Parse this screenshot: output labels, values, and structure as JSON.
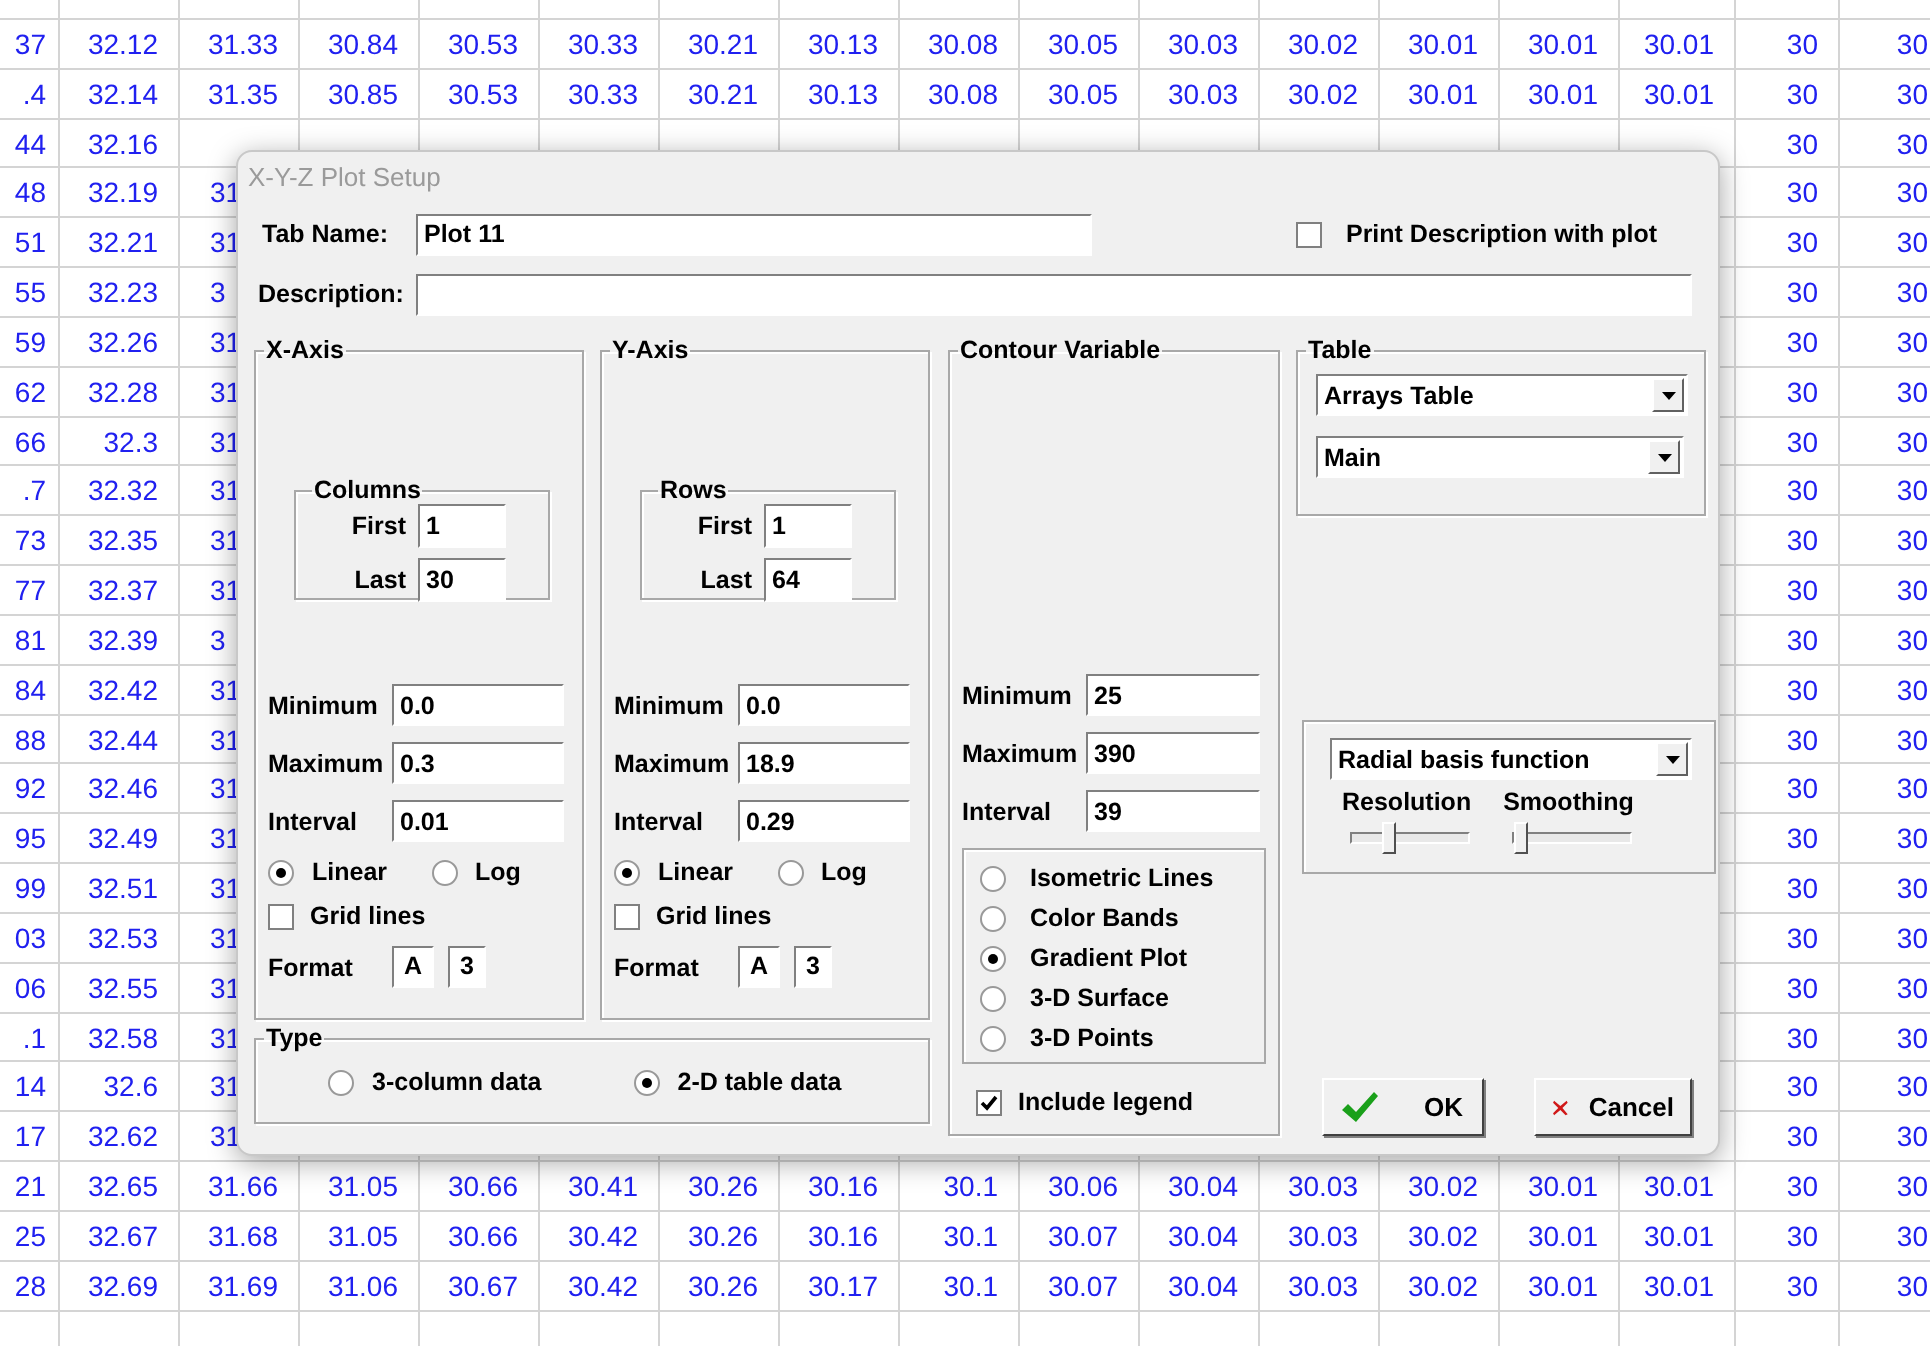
{
  "sheet": {
    "rows": [
      {
        "lead": [
          "37",
          "32.12",
          "31.33",
          "30.84",
          "30.53",
          "30.33",
          "30.21",
          "30.13",
          "30.08",
          "30.05",
          "30.03",
          "30.02",
          "30.01",
          "30.01",
          "30.01",
          "30",
          "30"
        ],
        "tail": []
      },
      {
        "lead": [
          ".4",
          "32.14",
          "31.35",
          "30.85",
          "30.53",
          "30.33",
          "30.21",
          "30.13",
          "30.08",
          "30.05",
          "30.03",
          "30.02",
          "30.01",
          "30.01",
          "30.01",
          "30",
          "30"
        ],
        "tail": []
      },
      {
        "lead": [
          "44",
          "32.16"
        ],
        "tail": [
          "30",
          "30"
        ]
      },
      {
        "lead": [
          "48",
          "32.19",
          "31"
        ],
        "tail": [
          "30",
          "30"
        ]
      },
      {
        "lead": [
          "51",
          "32.21",
          "31"
        ],
        "tail": [
          "30",
          "30"
        ]
      },
      {
        "lead": [
          "55",
          "32.23",
          "3"
        ],
        "tail": [
          "30",
          "30"
        ]
      },
      {
        "lead": [
          "59",
          "32.26",
          "31"
        ],
        "tail": [
          "30",
          "30"
        ]
      },
      {
        "lead": [
          "62",
          "32.28",
          "31"
        ],
        "tail": [
          "30",
          "30"
        ]
      },
      {
        "lead": [
          "66",
          "32.3",
          "31"
        ],
        "tail": [
          "30",
          "30"
        ]
      },
      {
        "lead": [
          ".7",
          "32.32",
          "31"
        ],
        "tail": [
          "30",
          "30"
        ]
      },
      {
        "lead": [
          "73",
          "32.35",
          "31"
        ],
        "tail": [
          "30",
          "30"
        ]
      },
      {
        "lead": [
          "77",
          "32.37",
          "31"
        ],
        "tail": [
          "30",
          "30"
        ]
      },
      {
        "lead": [
          "81",
          "32.39",
          "3"
        ],
        "tail": [
          "30",
          "30"
        ]
      },
      {
        "lead": [
          "84",
          "32.42",
          "31"
        ],
        "tail": [
          "30",
          "30"
        ]
      },
      {
        "lead": [
          "88",
          "32.44",
          "31"
        ],
        "tail": [
          "30",
          "30"
        ]
      },
      {
        "lead": [
          "92",
          "32.46",
          "31"
        ],
        "tail": [
          "30",
          "30"
        ]
      },
      {
        "lead": [
          "95",
          "32.49",
          "31"
        ],
        "tail": [
          "30",
          "30"
        ]
      },
      {
        "lead": [
          "99",
          "32.51",
          "31"
        ],
        "tail": [
          "30",
          "30"
        ]
      },
      {
        "lead": [
          "03",
          "32.53",
          "31"
        ],
        "tail": [
          "30",
          "30"
        ]
      },
      {
        "lead": [
          "06",
          "32.55",
          "31"
        ],
        "tail": [
          "30",
          "30"
        ]
      },
      {
        "lead": [
          ".1",
          "32.58",
          "31"
        ],
        "tail": [
          "30",
          "30"
        ]
      },
      {
        "lead": [
          "14",
          "32.6",
          "31"
        ],
        "tail": [
          "30",
          "30"
        ]
      },
      {
        "lead": [
          "17",
          "32.62",
          "31"
        ],
        "tail": [
          "30",
          "30"
        ]
      },
      {
        "lead": [
          "21",
          "32.65",
          "31.66",
          "31.05",
          "30.66",
          "30.41",
          "30.26",
          "30.16",
          "30.1",
          "30.06",
          "30.04",
          "30.03",
          "30.02",
          "30.01",
          "30.01",
          "30",
          "30"
        ],
        "tail": []
      },
      {
        "lead": [
          "25",
          "32.67",
          "31.68",
          "31.05",
          "30.66",
          "30.42",
          "30.26",
          "30.16",
          "30.1",
          "30.07",
          "30.04",
          "30.03",
          "30.02",
          "30.01",
          "30.01",
          "30",
          "30"
        ],
        "tail": []
      },
      {
        "lead": [
          "28",
          "32.69",
          "31.69",
          "31.06",
          "30.67",
          "30.42",
          "30.26",
          "30.17",
          "30.1",
          "30.07",
          "30.04",
          "30.03",
          "30.02",
          "30.01",
          "30.01",
          "30",
          "30"
        ],
        "tail": []
      }
    ]
  },
  "dialog": {
    "title": "X-Y-Z Plot Setup",
    "tab_name": {
      "label": "Tab Name:",
      "value": "Plot 11"
    },
    "print_description": {
      "label": "Print Description with plot",
      "checked": false
    },
    "description": {
      "label": "Description:"
    },
    "x_axis": {
      "title": "X-Axis",
      "range": {
        "title": "Columns",
        "first_label": "First",
        "first": "1",
        "last_label": "Last",
        "last": "30"
      },
      "minimum": {
        "label": "Minimum",
        "value": "0.0"
      },
      "maximum": {
        "label": "Maximum",
        "value": "0.3"
      },
      "interval": {
        "label": "Interval",
        "value": "0.01"
      },
      "scale": [
        {
          "label": "Linear",
          "selected": true
        },
        {
          "label": "Log",
          "selected": false
        }
      ],
      "grid_lines": {
        "label": "Grid lines",
        "checked": false
      },
      "format": {
        "label": "Format",
        "values": [
          "A",
          "3"
        ]
      }
    },
    "y_axis": {
      "title": "Y-Axis",
      "range": {
        "title": "Rows",
        "first_label": "First",
        "first": "1",
        "last_label": "Last",
        "last": "64"
      },
      "minimum": {
        "label": "Minimum",
        "value": "0.0"
      },
      "maximum": {
        "label": "Maximum",
        "value": "18.9"
      },
      "interval": {
        "label": "Interval",
        "value": "0.29"
      },
      "scale": [
        {
          "label": "Linear",
          "selected": true
        },
        {
          "label": "Log",
          "selected": false
        }
      ],
      "grid_lines": {
        "label": "Grid lines",
        "checked": false
      },
      "format": {
        "label": "Format",
        "values": [
          "A",
          "3"
        ]
      }
    },
    "contour": {
      "title": "Contour Variable",
      "minimum": {
        "label": "Minimum",
        "value": "25"
      },
      "maximum": {
        "label": "Maximum",
        "value": "390"
      },
      "interval": {
        "label": "Interval",
        "value": "39"
      },
      "plot_styles": [
        {
          "label": "Isometric Lines",
          "selected": false
        },
        {
          "label": "Color Bands",
          "selected": false
        },
        {
          "label": "Gradient Plot",
          "selected": true
        },
        {
          "label": "3-D Surface",
          "selected": false
        },
        {
          "label": "3-D Points",
          "selected": false
        }
      ],
      "include_legend": {
        "label": "Include legend",
        "checked": true
      }
    },
    "table": {
      "title": "Table",
      "selects": [
        "Arrays Table",
        "Main"
      ]
    },
    "interpolation": {
      "method": "Radial basis function",
      "sliders": [
        {
          "label": "Resolution",
          "level": 0.3
        },
        {
          "label": "Smoothing",
          "level": 0.03
        }
      ]
    },
    "type": {
      "title": "Type",
      "options": [
        {
          "label": "3-column data",
          "selected": false
        },
        {
          "label": "2-D table data",
          "selected": true
        }
      ]
    },
    "buttons": [
      {
        "label": "OK",
        "kind": "ok"
      },
      {
        "label": "Cancel",
        "kind": "cancel"
      }
    ]
  }
}
